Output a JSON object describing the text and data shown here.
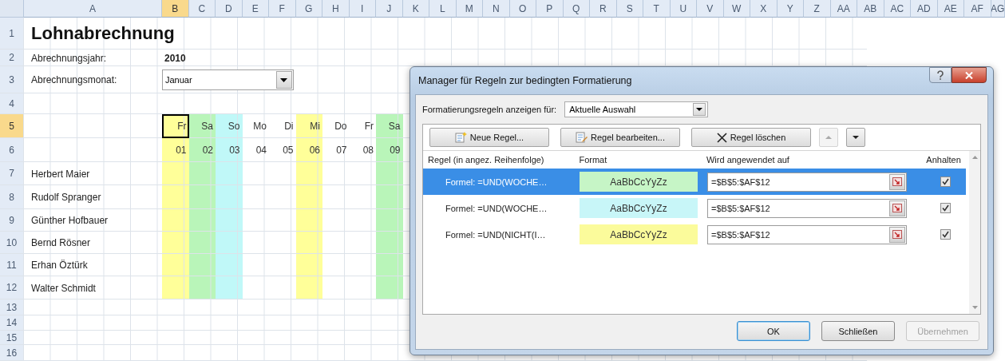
{
  "sheet": {
    "columns": [
      {
        "letter": "A",
        "selected": false
      },
      {
        "letter": "B",
        "selected": true
      },
      {
        "letter": "C",
        "selected": false
      },
      {
        "letter": "D",
        "selected": false
      },
      {
        "letter": "E",
        "selected": false
      },
      {
        "letter": "F",
        "selected": false
      },
      {
        "letter": "G",
        "selected": false
      },
      {
        "letter": "H",
        "selected": false
      },
      {
        "letter": "I",
        "selected": false
      },
      {
        "letter": "J",
        "selected": false
      },
      {
        "letter": "K",
        "selected": false
      },
      {
        "letter": "L",
        "selected": false
      },
      {
        "letter": "M",
        "selected": false
      },
      {
        "letter": "N",
        "selected": false
      },
      {
        "letter": "O",
        "selected": false
      },
      {
        "letter": "P",
        "selected": false
      },
      {
        "letter": "Q",
        "selected": false
      },
      {
        "letter": "R",
        "selected": false
      },
      {
        "letter": "S",
        "selected": false
      },
      {
        "letter": "T",
        "selected": false
      },
      {
        "letter": "U",
        "selected": false
      },
      {
        "letter": "V",
        "selected": false
      },
      {
        "letter": "W",
        "selected": false
      },
      {
        "letter": "X",
        "selected": false
      },
      {
        "letter": "Y",
        "selected": false
      },
      {
        "letter": "Z",
        "selected": false
      },
      {
        "letter": "AA",
        "selected": false
      },
      {
        "letter": "AB",
        "selected": false
      },
      {
        "letter": "AC",
        "selected": false
      },
      {
        "letter": "AD",
        "selected": false
      },
      {
        "letter": "AE",
        "selected": false
      },
      {
        "letter": "AF",
        "selected": false
      },
      {
        "letter": "AG",
        "selected": false
      }
    ],
    "rows": [
      {
        "number": "1",
        "selected": false
      },
      {
        "number": "2",
        "selected": false
      },
      {
        "number": "3",
        "selected": false
      },
      {
        "number": "4",
        "selected": false
      },
      {
        "number": "5",
        "selected": true
      },
      {
        "number": "6",
        "selected": false
      },
      {
        "number": "7",
        "selected": false
      },
      {
        "number": "8",
        "selected": false
      },
      {
        "number": "9",
        "selected": false
      },
      {
        "number": "10",
        "selected": false
      },
      {
        "number": "11",
        "selected": false
      },
      {
        "number": "12",
        "selected": false
      },
      {
        "number": "13",
        "selected": false
      },
      {
        "number": "14",
        "selected": false
      },
      {
        "number": "15",
        "selected": false
      },
      {
        "number": "16",
        "selected": false
      }
    ],
    "title": "Lohnabrechnung",
    "year_label": "Abrechnungsjahr:",
    "year": "2010",
    "month_label": "Abrechnungsmonat:",
    "month_dropdown": {
      "value": "Januar"
    },
    "days": [
      {
        "day": "Fr",
        "date": "01",
        "color": "#ffff99",
        "selected": true
      },
      {
        "day": "Sa",
        "date": "02",
        "color": "#b9f5b9",
        "selected": false
      },
      {
        "day": "So",
        "date": "03",
        "color": "#c0f8f8",
        "selected": false
      },
      {
        "day": "Mo",
        "date": "04",
        "selected": false
      },
      {
        "day": "Di",
        "date": "05",
        "selected": false
      },
      {
        "day": "Mi",
        "date": "06",
        "color": "#ffff99",
        "selected": false
      },
      {
        "day": "Do",
        "date": "07",
        "selected": false
      },
      {
        "day": "Fr",
        "date": "08",
        "selected": false
      },
      {
        "day": "Sa",
        "date": "09",
        "color": "#b9f5b9",
        "selected": false
      }
    ],
    "employees": [
      "Herbert Maier",
      "Rudolf Spranger",
      "Günther Hofbauer",
      "Bernd Rösner",
      "Erhan Öztürk",
      "Walter Schmidt"
    ]
  },
  "dialog": {
    "title": "Manager für Regeln zur bedingten Formatierung",
    "show_rules_for": {
      "label": "Formatierungsregeln anzeigen für:",
      "value": "Aktuelle Auswahl"
    },
    "toolbar": [
      {
        "kind": "new",
        "label": "Neue Regel...",
        "disabled": false
      },
      {
        "kind": "edit",
        "label": "Regel bearbeiten...",
        "disabled": false
      },
      {
        "kind": "delete",
        "label": "Regel löschen",
        "disabled": false
      },
      {
        "kind": "up",
        "disabled": true
      },
      {
        "kind": "down",
        "disabled": false
      }
    ],
    "columns": [
      "Regel (in angez. Reihenfolge)",
      "Format",
      "Wird angewendet auf",
      "Anhalten"
    ],
    "rules": [
      {
        "rule": "Formel: =UND(WOCHE…",
        "preview": "AaBbCcYyZz",
        "color": "#c6f5c6",
        "applies_to": "=$B$5:$AF$12",
        "stop": true,
        "selected": true
      },
      {
        "rule": "Formel: =UND(WOCHE…",
        "preview": "AaBbCcYyZz",
        "color": "#c8f6f8",
        "applies_to": "=$B$5:$AF$12",
        "stop": true,
        "selected": false
      },
      {
        "rule": "Formel: =UND(NICHT(I…",
        "preview": "AaBbCcYyZz",
        "color": "#fbfb9b",
        "applies_to": "=$B$5:$AF$12",
        "stop": true,
        "selected": false
      }
    ],
    "buttons": [
      {
        "label": "OK",
        "disabled": false
      },
      {
        "label": "Schließen",
        "disabled": false
      },
      {
        "label": "Übernehmen",
        "disabled": true
      }
    ]
  }
}
